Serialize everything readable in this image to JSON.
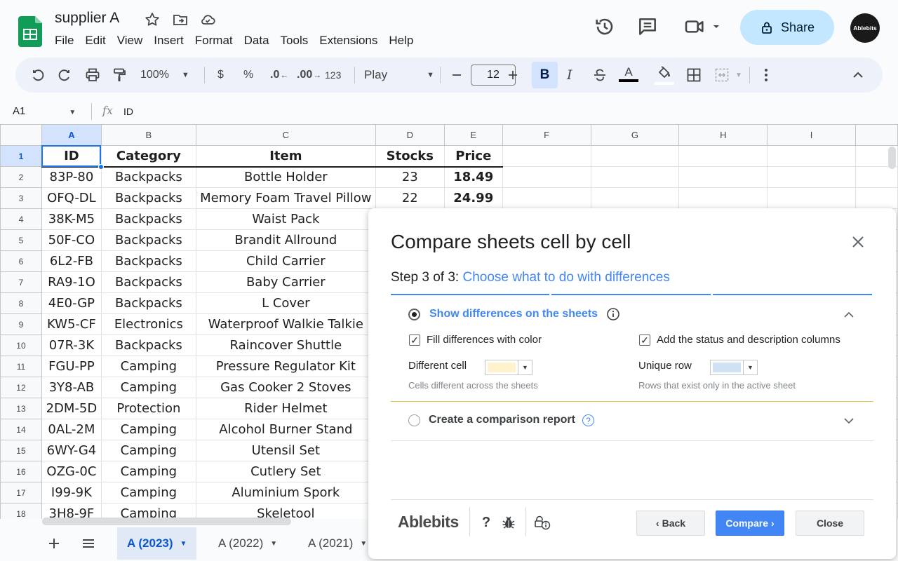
{
  "doc": {
    "title": "supplier A"
  },
  "menu": [
    "File",
    "Edit",
    "View",
    "Insert",
    "Format",
    "Data",
    "Tools",
    "Extensions",
    "Help"
  ],
  "header": {
    "share_label": "Share",
    "avatar_text": "Ablebits"
  },
  "toolbar": {
    "zoom": "100%",
    "currency": "$",
    "percent": "%",
    "dec_decrease": ".0",
    "dec_increase": ".00",
    "number_format": "123",
    "font": "Play",
    "font_size": "12",
    "bold": "B",
    "italic": "I",
    "text_color_glyph": "A"
  },
  "formula_bar": {
    "cell_ref": "A1",
    "fx": "fx",
    "content": "ID"
  },
  "grid": {
    "columns": [
      "A",
      "B",
      "C",
      "D",
      "E",
      "F",
      "G",
      "H",
      "I"
    ],
    "header_row": [
      "ID",
      "Category",
      "Item",
      "Stocks",
      "Price"
    ],
    "rows": [
      [
        "83P-80",
        "Backpacks",
        "Bottle Holder",
        "23",
        "18.49"
      ],
      [
        "OFQ-DL",
        "Backpacks",
        "Memory Foam Travel Pillow",
        "22",
        "24.99"
      ],
      [
        "38K-M5",
        "Backpacks",
        "Waist Pack",
        "",
        ""
      ],
      [
        "50F-CO",
        "Backpacks",
        "Brandit Allround",
        "",
        ""
      ],
      [
        "6L2-FB",
        "Backpacks",
        "Child Carrier",
        "",
        ""
      ],
      [
        "RA9-1O",
        "Backpacks",
        "Baby Carrier",
        "",
        ""
      ],
      [
        "4E0-GP",
        "Backpacks",
        "L Cover",
        "",
        ""
      ],
      [
        "KW5-CF",
        "Electronics",
        "Waterproof Walkie Talkie",
        "",
        ""
      ],
      [
        "07R-3K",
        "Backpacks",
        "Raincover Shuttle",
        "",
        ""
      ],
      [
        "FGU-PP",
        "Camping",
        "Pressure Regulator Kit",
        "",
        ""
      ],
      [
        "3Y8-AB",
        "Camping",
        "Gas Cooker 2 Stoves",
        "",
        ""
      ],
      [
        "2DM-5D",
        "Protection",
        "Rider Helmet",
        "",
        ""
      ],
      [
        "0AL-2M",
        "Camping",
        "Alcohol Burner Stand",
        "",
        ""
      ],
      [
        "6WY-G4",
        "Camping",
        "Utensil Set",
        "",
        ""
      ],
      [
        "OZG-0C",
        "Camping",
        "Cutlery Set",
        "",
        ""
      ],
      [
        "I99-9K",
        "Camping",
        "Aluminium Spork",
        "",
        ""
      ],
      [
        "3H8-9F",
        "Camping",
        "Skeletool",
        "",
        ""
      ]
    ]
  },
  "sheet_tabs": [
    "A (2023)",
    "A (2022)",
    "A (2021)"
  ],
  "dialog": {
    "title": "Compare sheets cell by cell",
    "step_prefix": "Step 3 of 3:",
    "step_title": "Choose what to do with differences",
    "section1": {
      "label": "Show differences on the sheets",
      "fill_label": "Fill differences with color",
      "status_label": "Add the status and description columns",
      "diff_cell_label": "Different cell",
      "diff_cell_color": "#fff2cc",
      "diff_cell_hint": "Cells different across the sheets",
      "unique_row_label": "Unique row",
      "unique_row_color": "#cfe2f3",
      "unique_row_hint": "Rows that exist only in the active sheet"
    },
    "section2": {
      "label": "Create a comparison report"
    },
    "footer": {
      "brand": "Ablebits",
      "help_glyph": "?",
      "back_label": "Back",
      "compare_label": "Compare",
      "close_label": "Close"
    }
  },
  "colors": {
    "accent": "#4285f4",
    "share_bg": "#c2e7ff",
    "selection": "#1a73e8"
  }
}
